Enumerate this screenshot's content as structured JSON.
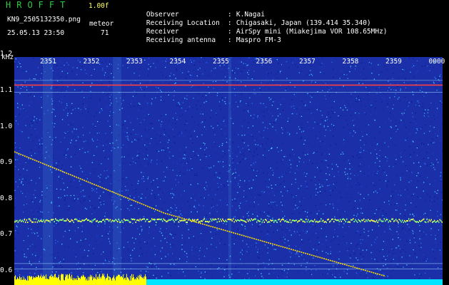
{
  "header": {
    "app_title": "HROFFT",
    "version": "1.00f",
    "file_name": "KN9_2505132350.png",
    "datetime": "25.05.13 23:50",
    "meteor_label": "meteor",
    "meteor_count": "71"
  },
  "info": [
    {
      "key": "Observer",
      "sep": ":",
      "value": "K.Nagai"
    },
    {
      "key": "Receiving Location",
      "sep": ":",
      "value": "Chigasaki, Japan (139.414 35.340)"
    },
    {
      "key": "Receiver",
      "sep": ":",
      "value": "AirSpy mini (Miakejima VOR 108.65MHz)"
    },
    {
      "key": "Receiving antenna",
      "sep": ":",
      "value": "Maspro FM-3"
    }
  ],
  "chart_data": {
    "type": "heatmap",
    "ylabel": "kHz",
    "y_ticks": [
      "1.2",
      "1.1",
      "1.0",
      "0.9",
      "0.8",
      "0.7",
      "0.6"
    ],
    "x_ticks": [
      "2351",
      "2352",
      "2353",
      "2354",
      "2355",
      "2356",
      "2357",
      "2358",
      "2359",
      "0000"
    ],
    "features": [
      {
        "name": "carrier",
        "freq_khz": 1.115,
        "color": "#ff4040"
      },
      {
        "name": "band",
        "freq_khz": 0.74,
        "color": "#ffff00"
      },
      {
        "name": "drift",
        "from_khz": 0.93,
        "to_khz": 0.585,
        "color": "#ffdd00"
      }
    ]
  }
}
